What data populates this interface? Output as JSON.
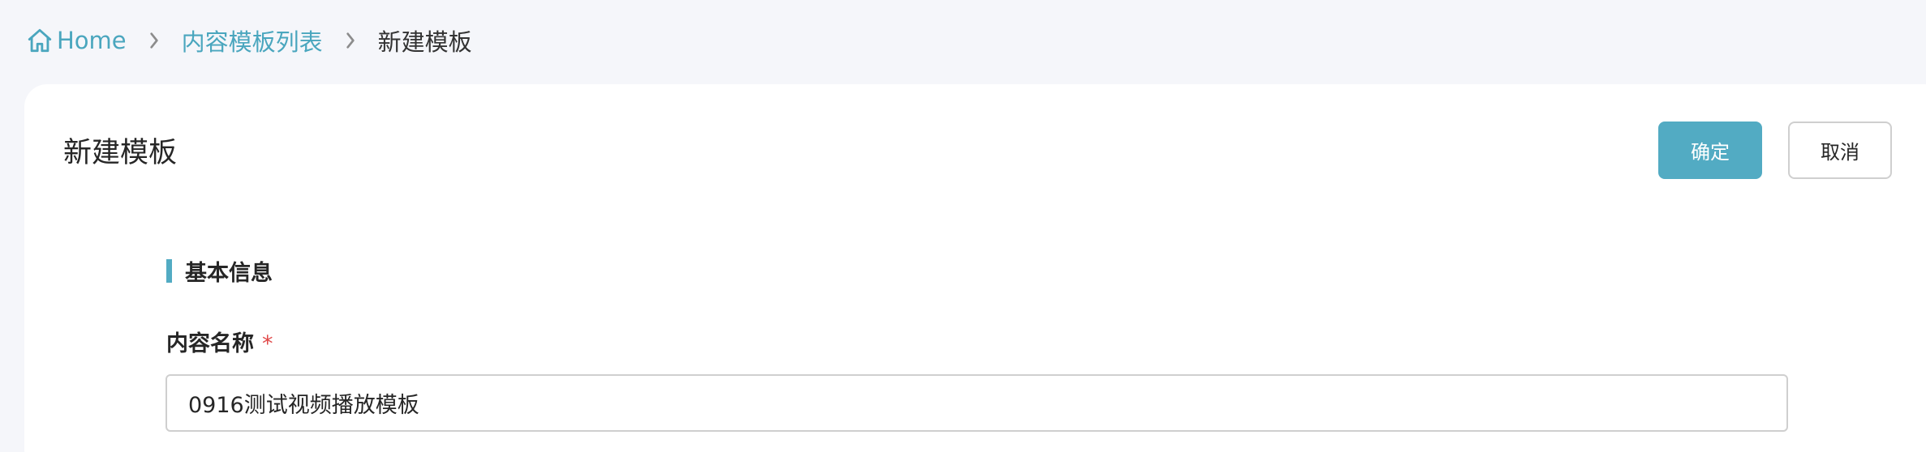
{
  "breadcrumb": {
    "home": "Home",
    "list": "内容模板列表",
    "current": "新建模板",
    "home_icon": "home-icon",
    "separator_icon": "chevron-right-icon"
  },
  "header": {
    "title": "新建模板",
    "confirm_label": "确定",
    "cancel_label": "取消"
  },
  "section": {
    "title": "基本信息"
  },
  "form": {
    "name_label": "内容名称",
    "required_mark": "*",
    "name_value": "0916测试视频播放模板"
  },
  "colors": {
    "accent": "#52abc3",
    "link": "#4aa6be",
    "required": "#e04a4a",
    "background": "#f5f6fa"
  }
}
